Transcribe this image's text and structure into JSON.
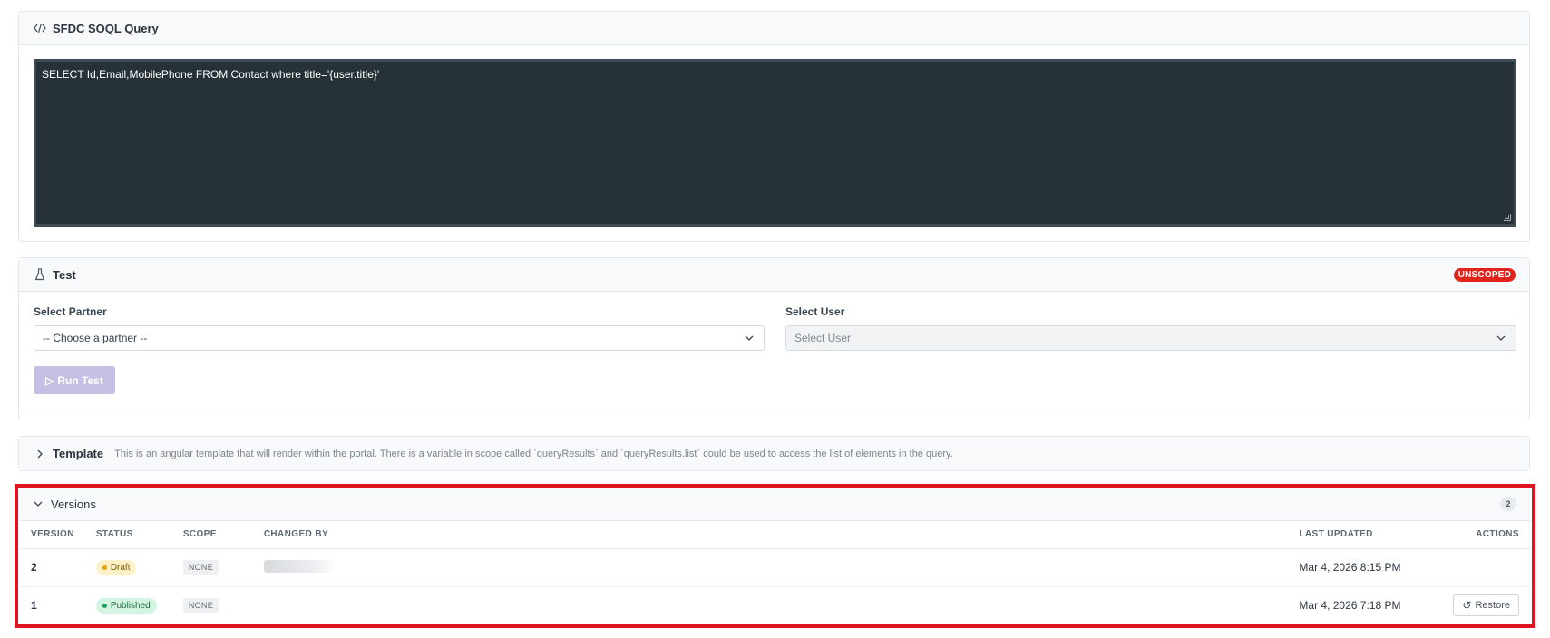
{
  "soql": {
    "title": "SFDC SOQL Query",
    "query": "SELECT Id,Email,MobilePhone FROM Contact where title='{user.title}'"
  },
  "test": {
    "title": "Test",
    "badge": "UNSCOPED",
    "partner_label": "Select Partner",
    "partner_value": "-- Choose a partner --",
    "user_label": "Select User",
    "user_value": "Select User",
    "run_label": "Run Test"
  },
  "template": {
    "title": "Template",
    "description": "This is an angular template that will render within the portal. There is a variable in scope called `queryResults` and `queryResults.list` could be used to access the list of elements in the query."
  },
  "versions": {
    "title": "Versions",
    "count": "2",
    "columns": {
      "version": "VERSION",
      "status": "STATUS",
      "scope": "SCOPE",
      "changed_by": "CHANGED BY",
      "last_updated": "LAST UPDATED",
      "actions": "ACTIONS"
    },
    "rows": [
      {
        "version": "2",
        "status": "Draft",
        "scope": "NONE",
        "last_updated": "Mar 4, 2026 8:15 PM",
        "action": ""
      },
      {
        "version": "1",
        "status": "Published",
        "scope": "NONE",
        "last_updated": "Mar 4, 2026 7:18 PM",
        "action": "Restore"
      }
    ]
  },
  "colors": {
    "code_bg": "#263238",
    "unscoped_badge": "#e0241b",
    "highlight_border": "#e0141e",
    "run_button": "#c5bfe3",
    "draft": "#fdf1c7",
    "published": "#d4f4e2"
  }
}
